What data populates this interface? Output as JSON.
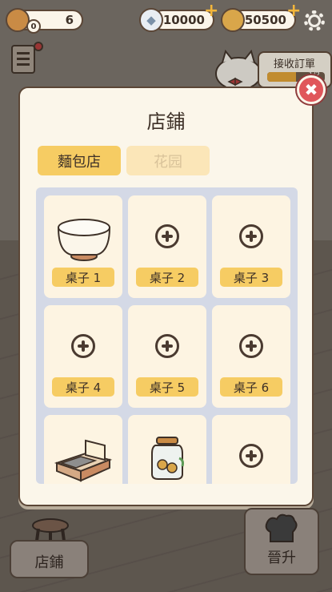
{
  "topbar": {
    "cookie_count": "6",
    "cookie_badge": "0",
    "gems": "10000",
    "coins": "50500",
    "plus_symbol": "+"
  },
  "order": {
    "label": "接收訂單",
    "progress_text": "1/2"
  },
  "panel": {
    "title": "店鋪",
    "close_symbol": "✖",
    "tabs": [
      {
        "label": "麵包店",
        "active": true
      },
      {
        "label": "花园",
        "active": false
      }
    ],
    "slots": [
      {
        "label": "桌子 1",
        "item": "round-table"
      },
      {
        "label": "桌子 2",
        "item": "empty"
      },
      {
        "label": "桌子 3",
        "item": "empty"
      },
      {
        "label": "桌子 4",
        "item": "empty"
      },
      {
        "label": "桌子 5",
        "item": "empty"
      },
      {
        "label": "桌子 6",
        "item": "empty"
      },
      {
        "label": "",
        "item": "display-counter"
      },
      {
        "label": "",
        "item": "cookie-jar"
      },
      {
        "label": "",
        "item": "empty"
      }
    ]
  },
  "bottom": {
    "shop_label": "店鋪",
    "upgrade_label": "晉升"
  },
  "colors": {
    "panel_bg": "#fbf6ea",
    "tab_active": "#f6cc63",
    "tab_inactive": "#fbe6b8",
    "slot_label": "#f6cc63",
    "close_red": "#e0565b"
  }
}
